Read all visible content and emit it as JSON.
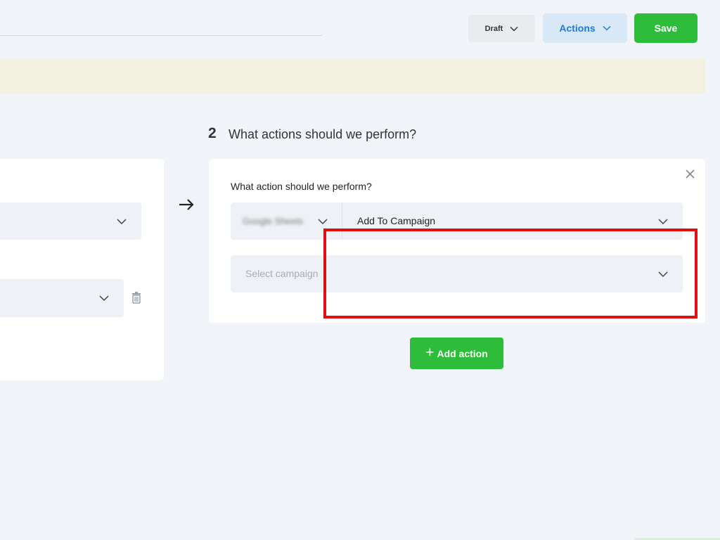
{
  "header": {
    "status_label": "Draft",
    "actions_label": "Actions",
    "save_label": "Save"
  },
  "step": {
    "number": "2",
    "title": "What actions should we perform?"
  },
  "action_card": {
    "question": "What action should we perform?",
    "app_value_blurred": "Google Sheets",
    "event_value": "Add To Campaign",
    "campaign_placeholder": "Select campaign"
  },
  "add_action_label": "Add action",
  "colors": {
    "primary_green": "#2ebd3a",
    "accent_blue": "#1f7ae0",
    "highlight_red": "#e01010",
    "banner": "#f3f1e1"
  },
  "icons": [
    "chevron-down-icon",
    "trash-icon",
    "arrow-right-icon",
    "close-icon",
    "plus-icon"
  ]
}
